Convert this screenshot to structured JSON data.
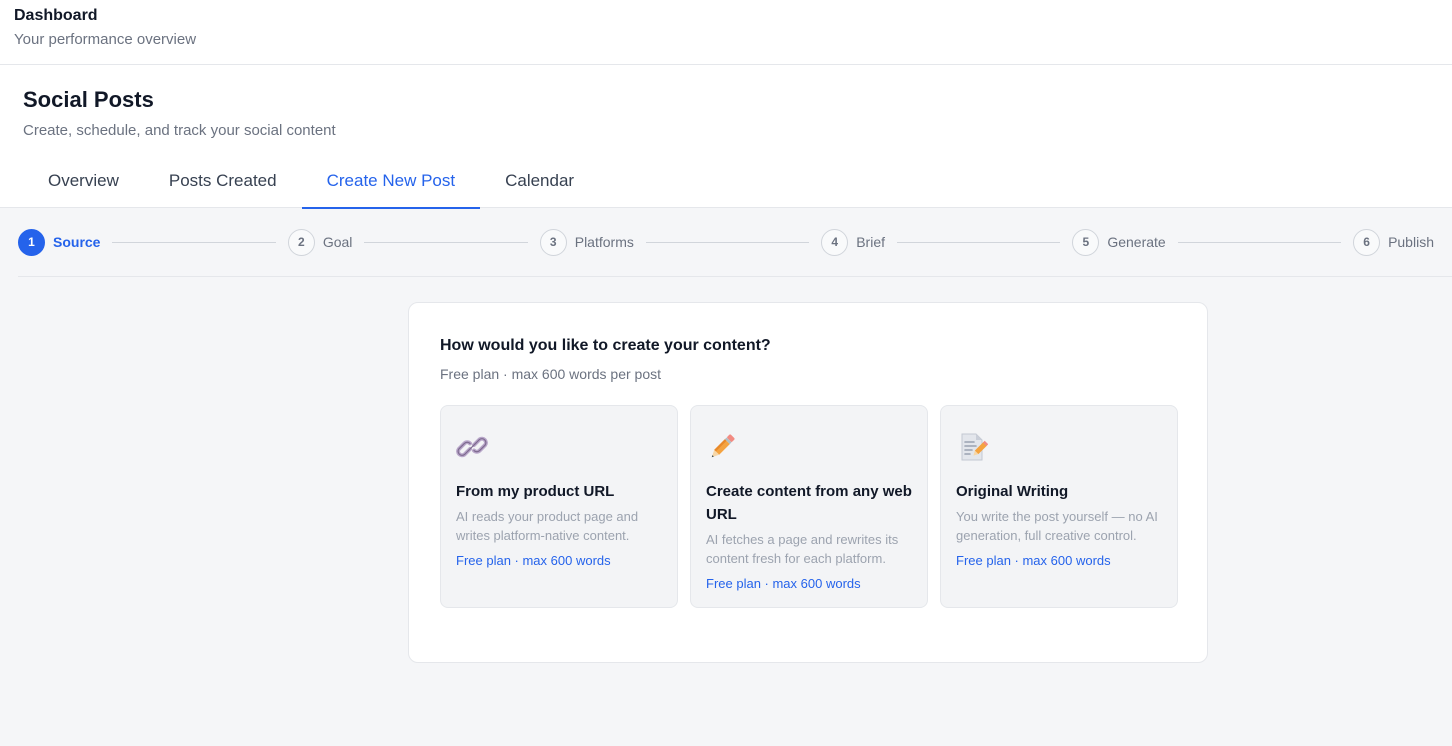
{
  "topbar": {
    "title": "Dashboard",
    "subtitle": "Your performance overview"
  },
  "header": {
    "title": "Social Posts",
    "subtitle": "Create, schedule, and track your social content"
  },
  "tabs": [
    {
      "label": "Overview",
      "active": false
    },
    {
      "label": "Posts Created",
      "active": false
    },
    {
      "label": "Create New Post",
      "active": true
    },
    {
      "label": "Calendar",
      "active": false
    }
  ],
  "steps": [
    {
      "number": "1",
      "label": "Source"
    },
    {
      "number": "2",
      "label": "Goal"
    },
    {
      "number": "3",
      "label": "Platforms"
    },
    {
      "number": "4",
      "label": "Brief"
    },
    {
      "number": "5",
      "label": "Generate"
    },
    {
      "number": "6",
      "label": "Publish"
    }
  ],
  "active_step": 1,
  "panel": {
    "title": "How would you like to create your content?",
    "subtitle": "Free plan · max 600 words per post"
  },
  "cards": [
    {
      "icon": "link-icon",
      "title": "From my product URL",
      "description": "AI reads your product page and writes platform-native content.",
      "plan": "Free plan · max 600 words"
    },
    {
      "icon": "pencil-icon",
      "title": "Create content from any web URL",
      "description": "AI fetches a page and rewrites its content fresh for each platform.",
      "plan": "Free plan · max 600 words"
    },
    {
      "icon": "memo-icon",
      "title": "Original Writing",
      "description": "You write the post yourself — no AI generation, full creative control.",
      "plan": "Free plan · max 600 words"
    }
  ],
  "colors": {
    "accent": "#2563eb",
    "background": "#f5f6f8",
    "card_background": "#f3f4f6",
    "muted_text": "#6b7280"
  }
}
